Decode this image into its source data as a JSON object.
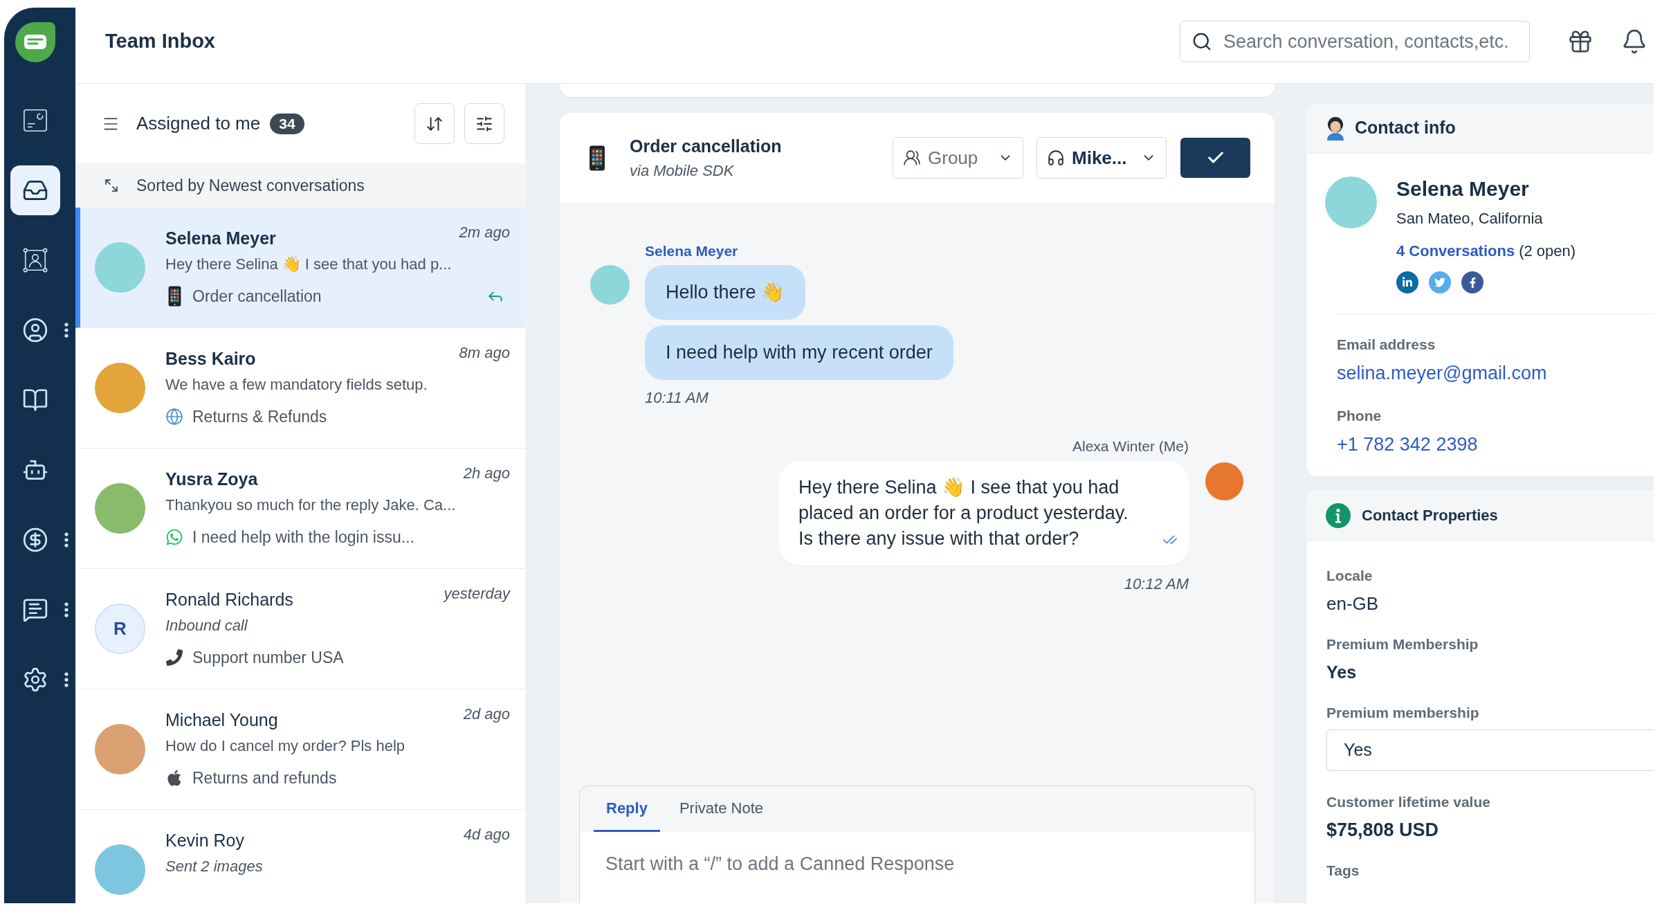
{
  "header": {
    "title": "Team Inbox",
    "search": {
      "placeholder": "Search conversation, contacts,etc."
    }
  },
  "sidebar": {
    "items": [
      {
        "selected": false,
        "menu": false
      },
      {
        "selected": true,
        "menu": false
      },
      {
        "selected": false,
        "menu": false
      },
      {
        "selected": false,
        "menu": true
      },
      {
        "selected": false,
        "menu": false
      },
      {
        "selected": false,
        "menu": false
      },
      {
        "selected": false,
        "menu": true
      },
      {
        "selected": false,
        "menu": true
      },
      {
        "selected": false,
        "menu": true
      }
    ]
  },
  "conversation_list": {
    "filter": {
      "label": "Assigned to me",
      "count": "34"
    },
    "sort_note": "Sorted by Newest conversations",
    "items": [
      {
        "name": "Selena Meyer",
        "time": "2m ago",
        "preview": "Hey there Selina 👋 I see that you had p...",
        "preview_italic": false,
        "channel": {
          "kind": "mobile",
          "label": "Order cancellation"
        },
        "avatar": {
          "kind": "photo",
          "color": "#8dd6da"
        },
        "unread": true,
        "selected": true,
        "replied": true
      },
      {
        "name": "Bess Kairo",
        "time": "8m ago",
        "preview": "We have a few mandatory fields setup.",
        "preview_italic": false,
        "channel": {
          "kind": "web",
          "label": "Returns & Refunds"
        },
        "avatar": {
          "kind": "photo",
          "color": "#e3a43c"
        },
        "unread": true,
        "selected": false,
        "replied": false
      },
      {
        "name": "Yusra Zoya",
        "time": "2h ago",
        "preview": "Thankyou so much for the reply Jake. Ca...",
        "preview_italic": false,
        "channel": {
          "kind": "whatsapp",
          "label": "I need help with the login issu..."
        },
        "avatar": {
          "kind": "photo",
          "color": "#88bb6a"
        },
        "unread": true,
        "selected": false,
        "replied": false
      },
      {
        "name": "Ronald Richards",
        "time": "yesterday",
        "preview": "Inbound call",
        "preview_italic": true,
        "channel": {
          "kind": "call",
          "label": "Support number USA"
        },
        "avatar": {
          "kind": "initial",
          "text": "R"
        },
        "unread": false,
        "selected": false,
        "replied": false
      },
      {
        "name": "Michael Young",
        "time": "2d ago",
        "preview": "How do I cancel my order? Pls help",
        "preview_italic": false,
        "channel": {
          "kind": "apple",
          "label": "Returns and refunds"
        },
        "avatar": {
          "kind": "photo",
          "color": "#d9a172"
        },
        "unread": false,
        "selected": false,
        "replied": false
      },
      {
        "name": "Kevin Roy",
        "time": "4d ago",
        "preview": "Sent 2 images",
        "preview_italic": true,
        "avatar": {
          "kind": "photo",
          "color": "#7cc6e0"
        },
        "unread": false,
        "selected": false,
        "replied": false
      }
    ]
  },
  "chat": {
    "title": "Order cancellation",
    "subtitle": "via Mobile SDK",
    "channel": {
      "kind": "mobile"
    },
    "group_select": {
      "placeholder": "Group"
    },
    "agent_select": {
      "value": "Mike..."
    },
    "messages": [
      {
        "kind": "incoming",
        "sender": "Selena Meyer",
        "avatar": {
          "kind": "photo",
          "color": "#8dd6da"
        },
        "bubbles": [
          {
            "lines": [
              "Hello there 👋"
            ]
          },
          {
            "lines": [
              "I need help with my recent order"
            ]
          }
        ],
        "time": "10:11 AM"
      },
      {
        "kind": "outgoing",
        "sender": "Alexa Winter (Me)",
        "avatar": {
          "kind": "photo",
          "color": "#e8772e"
        },
        "bubbles": [
          {
            "lines": [
              "Hey there Selina 👋 I see that you had",
              "placed an order for a product yesterday.",
              "Is there any issue with that order?"
            ]
          }
        ],
        "read": true,
        "time": "10:12 AM"
      }
    ],
    "composer": {
      "tabs": [
        {
          "label": "Reply",
          "selected": true
        },
        {
          "label": "Private Note",
          "selected": false
        }
      ],
      "placeholder": "Start with a “/” to add a Canned Response"
    }
  },
  "contact_info": {
    "title": "Contact info",
    "name": "Selena Meyer",
    "location": "San Mateo, California",
    "conversations_link": "4 Conversations",
    "open_count": "(2 open)",
    "avatar": {
      "kind": "photo",
      "color": "#8dd6da"
    },
    "fields": [
      {
        "label": "Email address",
        "value": "selina.meyer@gmail.com"
      },
      {
        "label": "Phone",
        "value": "+1 782 342 2398"
      }
    ]
  },
  "contact_properties": {
    "title": "Contact Properties",
    "properties": [
      {
        "kind": "text",
        "label": "Locale",
        "value": "en-GB"
      },
      {
        "kind": "boolean",
        "label": "Premium Membership",
        "value": "Yes"
      },
      {
        "kind": "select",
        "label": "Premium membership",
        "value": "Yes"
      },
      {
        "kind": "currency",
        "label": "Customer lifetime value",
        "value": "$75,808 USD"
      },
      {
        "kind": "tags",
        "label": "Tags"
      }
    ]
  }
}
